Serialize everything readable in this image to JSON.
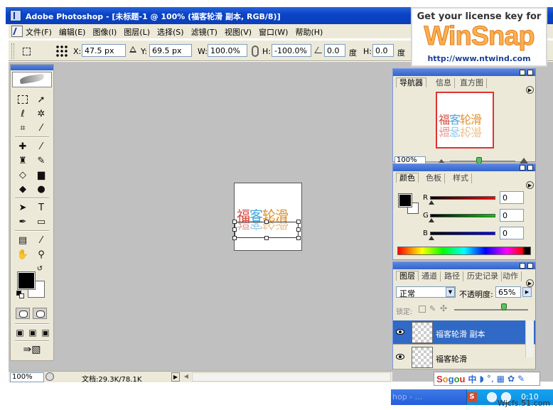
{
  "window": {
    "title": "Adobe Photoshop - [未标题-1 @ 100% (福客轮滑 副本, RGB/8)]"
  },
  "menu": [
    "文件(F)",
    "编辑(E)",
    "图像(I)",
    "图层(L)",
    "选择(S)",
    "滤镜(T)",
    "视图(V)",
    "窗口(W)",
    "帮助(H)"
  ],
  "options": {
    "x_label": "X:",
    "x_value": "47.5 px",
    "y_label": "Y:",
    "y_value": "69.5 px",
    "w_label": "W:",
    "w_value": "100.0%",
    "h_label": "H:",
    "h_value": "-100.0%",
    "angle_value": "0.0",
    "angle_unit": "度",
    "hskew_label": "H:",
    "hskew_value": "0.0",
    "hskew_unit": "度"
  },
  "canvas": {
    "text_chars": [
      "福",
      "客",
      "轮",
      "滑"
    ]
  },
  "status": {
    "zoom": "100%",
    "doc_info": "文档:29.3K/78.1K"
  },
  "navigator": {
    "tabs": [
      "导航器",
      "信息",
      "直方图"
    ],
    "zoom": "100%"
  },
  "color": {
    "tabs": [
      "颜色",
      "色板",
      "样式"
    ],
    "rows": [
      {
        "label": "R",
        "value": "0"
      },
      {
        "label": "G",
        "value": "0"
      },
      {
        "label": "B",
        "value": "0"
      }
    ]
  },
  "layers": {
    "tabs": [
      "图层",
      "通道",
      "路径",
      "历史记录",
      "动作"
    ],
    "blend_mode": "正常",
    "opacity_label": "不透明度:",
    "opacity_value": "65%",
    "lock_label": "锁定:",
    "items": [
      {
        "name": "福客轮滑 副本",
        "active": true
      },
      {
        "name": "福客轮滑",
        "active": false
      }
    ]
  },
  "ad": {
    "line1": "Get your license key for",
    "brand": "WinSnap",
    "url": "http://www.ntwind.com"
  },
  "taskbar": {
    "left_text": "hop - ...",
    "clock": "0:10",
    "tray_letter": "S"
  },
  "sogou": {
    "brand": "Sogou",
    "mode": "中"
  },
  "watermark": "Wjcfs.51.com",
  "colors": {
    "title_blue": "#0a44c8",
    "chrome": "#ece9d8",
    "workspace": "#c0c0c0",
    "red_char": "#d6493d",
    "blue_char": "#4aa7d8",
    "orange_char": "#e1902c",
    "active_layer": "#3169c6"
  }
}
